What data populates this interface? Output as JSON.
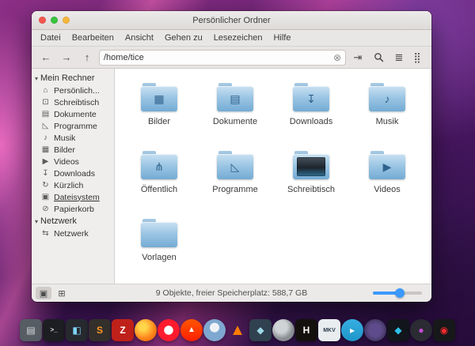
{
  "window": {
    "title": "Persönlicher Ordner",
    "traffic_lights": [
      "#f5564e",
      "#3bc23f",
      "#f5b63d"
    ],
    "menubar": [
      "Datei",
      "Bearbeiten",
      "Ansicht",
      "Gehen zu",
      "Lesezeichen",
      "Hilfe"
    ],
    "toolbar": {
      "path": "/home/tice",
      "icons": {
        "back": "←",
        "forward": "→",
        "up": "↑",
        "clear": "⊗",
        "new_tab": "⇥",
        "list_view": "≣",
        "icon_view": "⣿"
      }
    },
    "sidebar": {
      "sections": [
        {
          "label": "Mein Rechner",
          "items": [
            {
              "label": "Persönlich...",
              "icon": "home"
            },
            {
              "label": "Schreibtisch",
              "icon": "desktop"
            },
            {
              "label": "Dokumente",
              "icon": "document"
            },
            {
              "label": "Programme",
              "icon": "tools"
            },
            {
              "label": "Musik",
              "icon": "music"
            },
            {
              "label": "Bilder",
              "icon": "image"
            },
            {
              "label": "Videos",
              "icon": "video"
            },
            {
              "label": "Downloads",
              "icon": "download"
            },
            {
              "label": "Kürzlich",
              "icon": "clock"
            },
            {
              "label": "Dateisystem",
              "icon": "disk",
              "underline": true
            },
            {
              "label": "Papierkorb",
              "icon": "trash"
            }
          ]
        },
        {
          "label": "Netzwerk",
          "items": [
            {
              "label": "Netzwerk",
              "icon": "network"
            }
          ]
        }
      ]
    },
    "folders": [
      {
        "label": "Bilder",
        "emblem": "image"
      },
      {
        "label": "Dokumente",
        "emblem": "document"
      },
      {
        "label": "Downloads",
        "emblem": "download"
      },
      {
        "label": "Musik",
        "emblem": "music"
      },
      {
        "label": "Öffentlich",
        "emblem": "share"
      },
      {
        "label": "Programme",
        "emblem": "tools"
      },
      {
        "label": "Schreibtisch",
        "emblem": "desktop"
      },
      {
        "label": "Videos",
        "emblem": "video"
      },
      {
        "label": "Vorlagen",
        "emblem": "none"
      }
    ],
    "statusbar": {
      "text": "9 Objekte, freier Speicherplatz: 588,7 GB",
      "zoom_percent": 55,
      "icons": {
        "dir_tree": "▣",
        "split": "⊞"
      }
    }
  },
  "dock": {
    "items": [
      {
        "name": "file-manager",
        "bg": "#565d64",
        "glyph": "▤",
        "glyph_color": "#d8dce0"
      },
      {
        "name": "terminal",
        "bg": "#1c1e22",
        "glyph": ">_",
        "glyph_color": "#e8e8e8",
        "glyph_size": 8
      },
      {
        "name": "text-editor",
        "bg": "#26292e",
        "glyph": "◧",
        "glyph_color": "#7fd4ff"
      },
      {
        "name": "sublime-text",
        "bg": "#332f2b",
        "glyph": "S",
        "glyph_color": "#ff9724"
      },
      {
        "name": "filezilla",
        "bg": "#bf211a",
        "glyph": "Z",
        "glyph_color": "#ffffff"
      },
      {
        "name": "firefox",
        "bg": "radial-gradient(circle at 38% 35%, #ffd54a 0 18%, #ff8a1e 55%, #e25a00 100%)",
        "round": true
      },
      {
        "name": "opera",
        "bg": "radial-gradient(circle, #ffffff 0 28%, #ff1b2d 30% 100%)",
        "round": true
      },
      {
        "name": "brave",
        "bg": "linear-gradient(180deg,#ff5500,#ff2000)",
        "glyph": "▲",
        "glyph_color": "#ffffff",
        "glyph_size": 10,
        "round": true
      },
      {
        "name": "chromium",
        "bg": "radial-gradient(circle at 50% 38%, #eef2f6 0 26%, #7fa8d0 28% 100%)",
        "round": true
      },
      {
        "name": "vlc",
        "bg": "transparent",
        "flat": true,
        "glyph": "▲",
        "glyph_color": "#ff7d00",
        "glyph_size": 20
      },
      {
        "name": "darktable",
        "bg": "#30414f",
        "glyph": "◆",
        "glyph_color": "#9fd8e8"
      },
      {
        "name": "gimp",
        "bg": "radial-gradient(circle at 40% 35%, #cfd3d6 0 30%, #8a8f94 60%)",
        "round": true
      },
      {
        "name": "handbrake",
        "bg": "#14100e",
        "glyph": "H",
        "glyph_color": "#ffffff"
      },
      {
        "name": "mkvtoolnix",
        "bg": "#e9edf0",
        "glyph": "MKV",
        "glyph_color": "#2a3b4c",
        "glyph_size": 7
      },
      {
        "name": "telegram",
        "bg": "linear-gradient(180deg,#37aee2,#1e96c8)",
        "glyph": "▸",
        "glyph_color": "#ffffff",
        "round": true
      },
      {
        "name": "tor-browser",
        "bg": "radial-gradient(circle, #5e4b8b 0 40%, #2a2640 100%)",
        "round": true
      },
      {
        "name": "kodi",
        "bg": "#12151c",
        "glyph": "◆",
        "glyph_color": "#2fc1ea"
      },
      {
        "name": "audacity",
        "bg": "#2b2b33",
        "glyph": "●",
        "glyph_color": "#c34cd6",
        "round": true
      },
      {
        "name": "youtube",
        "bg": "#17181a",
        "glyph": "◉",
        "glyph_color": "#ff2b2b"
      }
    ]
  }
}
